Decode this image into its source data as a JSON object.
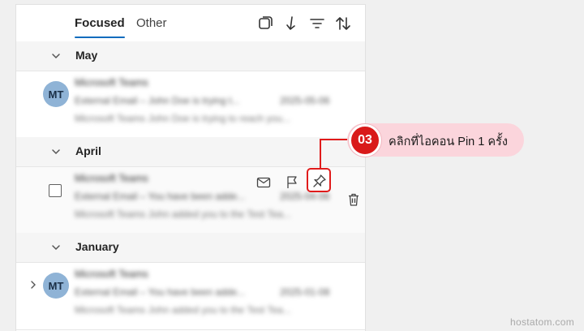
{
  "tabs": {
    "focused": "Focused",
    "other": "Other"
  },
  "toolbar_icons": [
    "select-mode-icon",
    "jump-down-icon",
    "filter-icon",
    "sort-icon"
  ],
  "groups": [
    {
      "label": "May",
      "messages": [
        {
          "avatar_initials": "MT",
          "sender": "Microsoft Teams",
          "subject": "External Email – John Doe is trying t...",
          "date": "2025-05-06",
          "preview": "Microsoft Teams John Doe is trying to reach you..."
        }
      ]
    },
    {
      "label": "April",
      "messages": [
        {
          "sender": "Microsoft Teams",
          "subject": "External Email – You have been adde...",
          "date": "2025-04-06",
          "preview": "Microsoft Teams John added you to the Test Tea...",
          "hover_actions": [
            "mark-read-icon",
            "flag-icon",
            "pin-icon",
            "delete-icon"
          ]
        }
      ]
    },
    {
      "label": "January",
      "messages": [
        {
          "avatar_initials": "MT",
          "sender": "Microsoft Teams",
          "subject": "External Email – You have been adde...",
          "date": "2025-01-08",
          "preview": "Microsoft Teams John added you to the Test Tea..."
        }
      ]
    }
  ],
  "callout": {
    "step": "03",
    "text": "คลิกที่ไอคอน Pin 1 ครั้ง"
  },
  "watermark": "hostatom.com",
  "colors": {
    "accent": "#0f6cbd",
    "callout_red": "#d91a1a",
    "callout_bg": "#fbd5dc"
  }
}
